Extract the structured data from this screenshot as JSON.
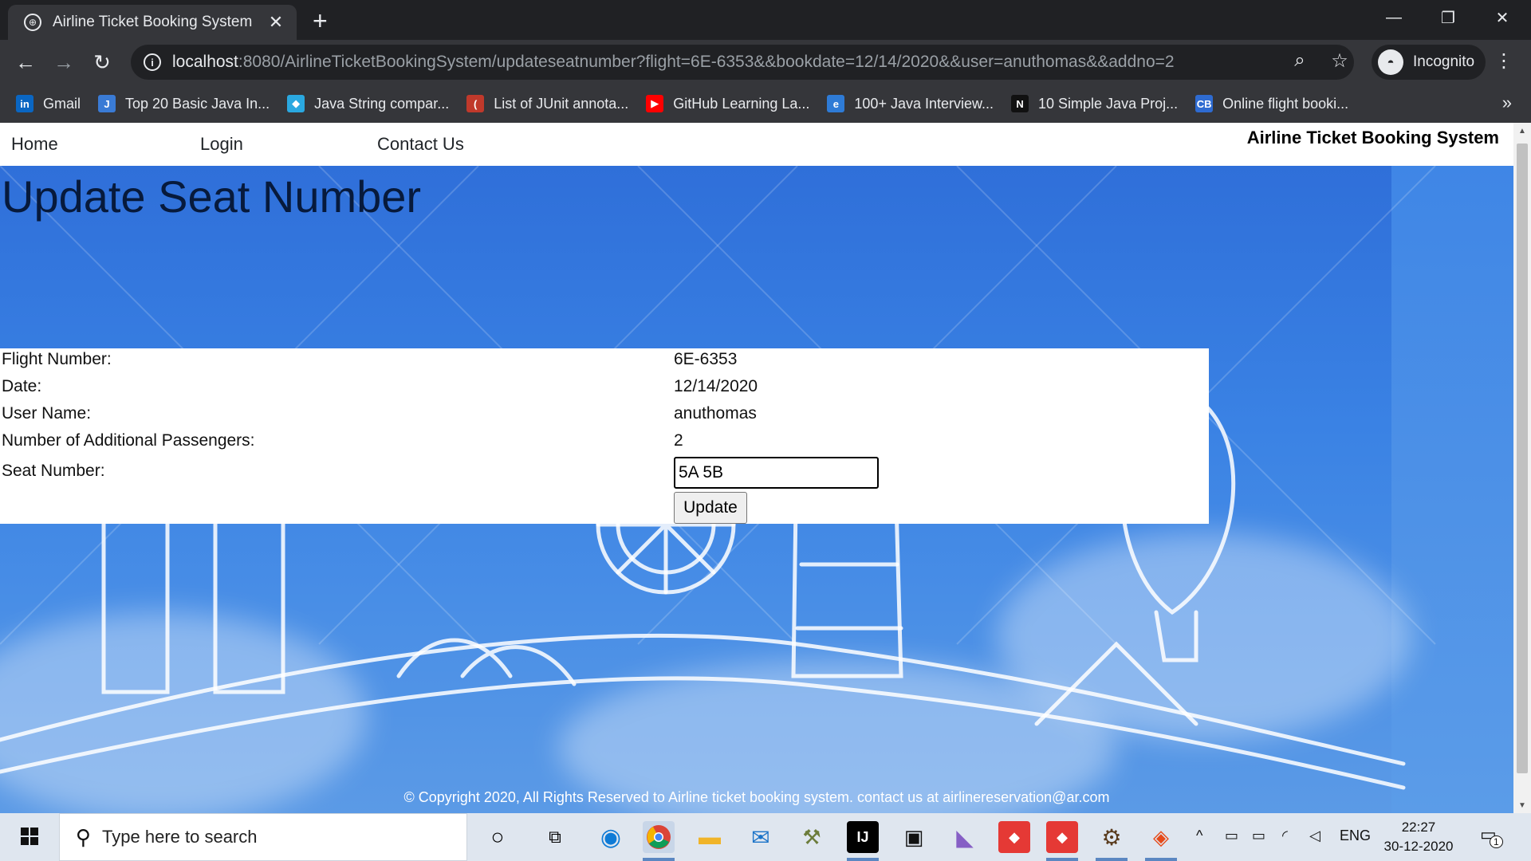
{
  "browser": {
    "tab_title": "Airline Ticket Booking System",
    "url_host": "localhost",
    "url_rest": ":8080/AirlineTicketBookingSystem/updateseatnumber?flight=6E-6353&&bookdate=12/14/2020&&user=anuthomas&&addno=2",
    "incognito_label": "Incognito",
    "bookmarks": [
      {
        "label": "Gmail",
        "icon": "linkedin-icon",
        "color": "#0a66c2",
        "glyph": "in"
      },
      {
        "label": "Top 20 Basic Java In...",
        "icon": "java-page-icon",
        "color": "#3a7bd5",
        "glyph": "J"
      },
      {
        "label": "Java String compar...",
        "icon": "diamond-icon",
        "color": "#2aa8e0",
        "glyph": "◆"
      },
      {
        "label": "List of JUnit annota...",
        "icon": "junit-icon",
        "color": "#c0392b",
        "glyph": "("
      },
      {
        "label": "GitHub Learning La...",
        "icon": "youtube-icon",
        "color": "#ff0000",
        "glyph": "▶"
      },
      {
        "label": "100+ Java Interview...",
        "icon": "e-icon",
        "color": "#2e7bd6",
        "glyph": "e"
      },
      {
        "label": "10 Simple Java Proj...",
        "icon": "n-icon",
        "color": "#111111",
        "glyph": "N"
      },
      {
        "label": "Online flight booki...",
        "icon": "cb-icon",
        "color": "#2e6bd1",
        "glyph": "CB"
      }
    ]
  },
  "nav": {
    "home": "Home",
    "login": "Login",
    "contact": "Contact Us",
    "brand": "Airline Ticket Booking System"
  },
  "page": {
    "title": "Update Seat Number",
    "fields": {
      "flight_label": "Flight Number:",
      "flight_value": "6E-6353",
      "date_label": "Date:",
      "date_value": "12/14/2020",
      "user_label": "User Name:",
      "user_value": "anuthomas",
      "passengers_label": "Number of Additional Passengers:",
      "passengers_value": "2",
      "seat_label": "Seat Number:",
      "seat_value": "5A 5B"
    },
    "update_button": "Update",
    "footer": "© Copyright 2020, All Rights Reserved to Airline ticket booking system. contact us at airlinereservation@ar.com"
  },
  "taskbar": {
    "search_placeholder": "Type here to search",
    "language": "ENG",
    "time": "22:27",
    "date": "30-12-2020",
    "notification_count": "1"
  }
}
